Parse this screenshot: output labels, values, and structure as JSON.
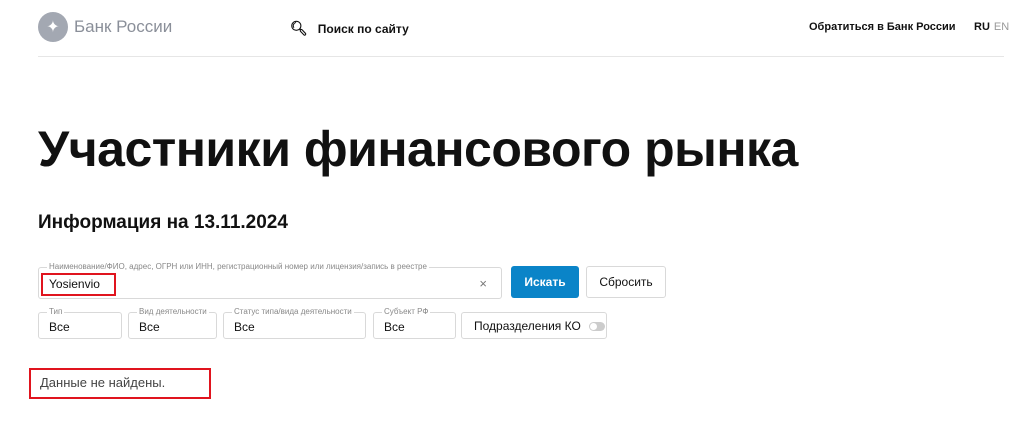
{
  "header": {
    "logo_text": "Банк России",
    "search_label": "Поиск по сайту",
    "contact_label": "Обратиться в Банк России",
    "lang_ru": "RU",
    "lang_en": "EN"
  },
  "page": {
    "title": "Участники финансового рынка",
    "subtitle": "Информация на 13.11.2024"
  },
  "search": {
    "label": "Наименование/ФИО, адрес, ОГРН или ИНН, регистрационный номер или лицензия/запись в реестре",
    "value": "Yosienvio",
    "clear": "×",
    "submit": "Искать",
    "reset": "Сбросить"
  },
  "filters": [
    {
      "label": "Тип",
      "value": "Все"
    },
    {
      "label": "Вид деятельности",
      "value": "Все"
    },
    {
      "label": "Статус типа/вида деятельности",
      "value": "Все"
    },
    {
      "label": "Субъект РФ",
      "value": "Все"
    }
  ],
  "toggle": {
    "label": "Подразделения КО",
    "on": false
  },
  "result": {
    "message": "Данные не найдены."
  },
  "colors": {
    "accent": "#0a84c8"
  }
}
